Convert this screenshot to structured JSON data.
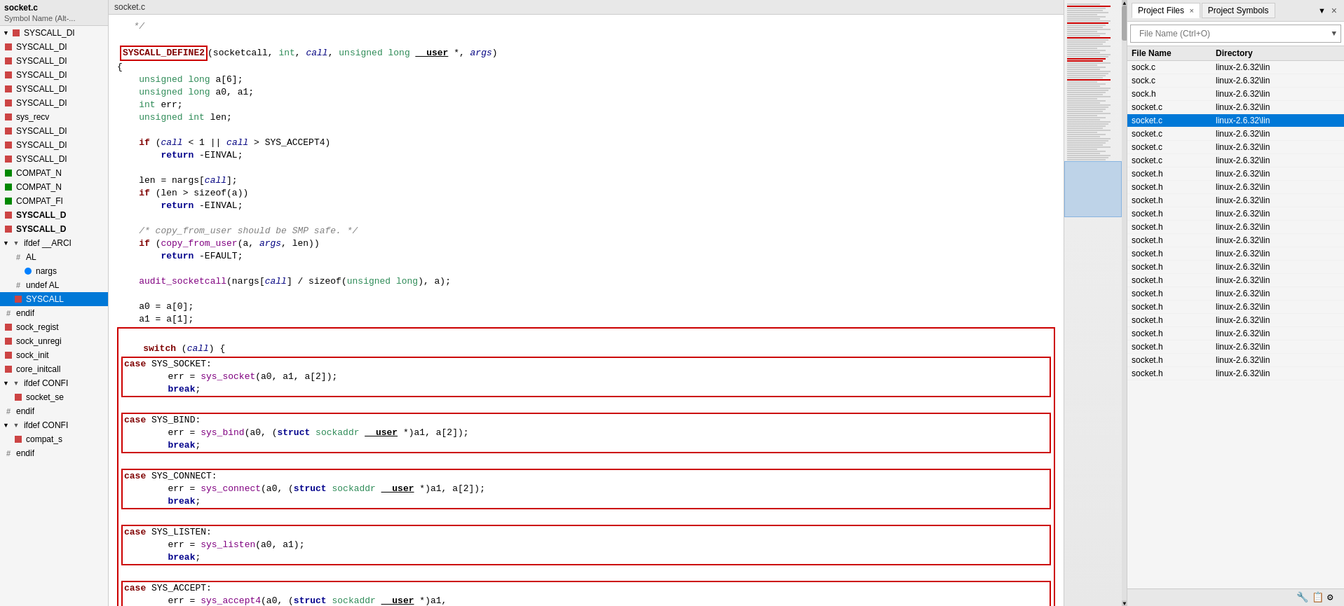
{
  "app": {
    "title": "socket.c"
  },
  "sidebar": {
    "search_placeholder": "Symbol Name (Alt-...",
    "items": [
      {
        "id": "s1",
        "label": "SYSCALL_DI",
        "icon": "sq-red",
        "indent": 0,
        "expanded": true
      },
      {
        "id": "s2",
        "label": "SYSCALL_DI",
        "icon": "sq-red",
        "indent": 0
      },
      {
        "id": "s3",
        "label": "SYSCALL_DI",
        "icon": "sq-red",
        "indent": 0
      },
      {
        "id": "s4",
        "label": "SYSCALL_DI",
        "icon": "sq-red",
        "indent": 0
      },
      {
        "id": "s5",
        "label": "SYSCALL_DI",
        "icon": "sq-red",
        "indent": 0
      },
      {
        "id": "s6",
        "label": "SYSCALL_DI",
        "icon": "sq-red",
        "indent": 0
      },
      {
        "id": "s7",
        "label": "sys_recv",
        "icon": "sq-red",
        "indent": 0
      },
      {
        "id": "s8",
        "label": "SYSCALL_DI",
        "icon": "sq-red",
        "indent": 0
      },
      {
        "id": "s9",
        "label": "SYSCALL_DI",
        "icon": "sq-red",
        "indent": 0
      },
      {
        "id": "s10",
        "label": "SYSCALL_DI",
        "icon": "sq-red",
        "indent": 0
      },
      {
        "id": "s11",
        "label": "COMPAT_N",
        "icon": "sq-green",
        "indent": 0
      },
      {
        "id": "s12",
        "label": "COMPAT_N",
        "icon": "sq-green",
        "indent": 0
      },
      {
        "id": "s13",
        "label": "COMPAT_FI",
        "icon": "sq-green",
        "indent": 0
      },
      {
        "id": "s14",
        "label": "SYSCALL_D",
        "icon": "sq-red",
        "indent": 0,
        "bold": true
      },
      {
        "id": "s15",
        "label": "SYSCALL_D",
        "icon": "sq-red",
        "indent": 0,
        "bold": true
      },
      {
        "id": "s16",
        "label": "ifdef __ARCI",
        "icon": "collapse",
        "indent": 0,
        "expanded": true
      },
      {
        "id": "s17",
        "label": "AL",
        "icon": "hash",
        "indent": 1
      },
      {
        "id": "s18",
        "label": "nargs",
        "icon": "circle-blue",
        "indent": 2
      },
      {
        "id": "s19",
        "label": "undef AL",
        "icon": "hash",
        "indent": 1
      },
      {
        "id": "s20",
        "label": "SYSCALL",
        "icon": "sq-red",
        "indent": 1,
        "selected": true
      },
      {
        "id": "s21",
        "label": "endif",
        "icon": "hash",
        "indent": 0
      },
      {
        "id": "s22",
        "label": "sock_regist",
        "icon": "sq-red",
        "indent": 0
      },
      {
        "id": "s23",
        "label": "sock_unregi",
        "icon": "sq-red",
        "indent": 0
      },
      {
        "id": "s24",
        "label": "sock_init",
        "icon": "sq-red",
        "indent": 0
      },
      {
        "id": "s25",
        "label": "core_initcall",
        "icon": "sq-red",
        "indent": 0
      },
      {
        "id": "s26",
        "label": "ifdef CONFI",
        "icon": "collapse",
        "indent": 0,
        "expanded": true
      },
      {
        "id": "s27",
        "label": "socket_se",
        "icon": "sq-red",
        "indent": 1
      },
      {
        "id": "s28",
        "label": "endif",
        "icon": "hash",
        "indent": 0
      },
      {
        "id": "s29",
        "label": "ifdef CONFI",
        "icon": "collapse",
        "indent": 0,
        "expanded": true
      },
      {
        "id": "s30",
        "label": "compat_s",
        "icon": "sq-red",
        "indent": 1
      },
      {
        "id": "s31",
        "label": "endif",
        "icon": "hash",
        "indent": 0
      }
    ]
  },
  "code": {
    "file": "socket.c",
    "content_lines": []
  },
  "right_panel": {
    "tabs": [
      {
        "label": "Project Files",
        "active": true
      },
      {
        "label": "Project Symbols",
        "active": false
      }
    ],
    "search_placeholder": "File Name (Ctrl+O)",
    "columns": [
      "File Name",
      "Directory"
    ],
    "rows": [
      {
        "filename": "sock.c",
        "directory": "linux-2.6.32\\lin",
        "selected": false
      },
      {
        "filename": "sock.c",
        "directory": "linux-2.6.32\\lin",
        "selected": false
      },
      {
        "filename": "sock.h",
        "directory": "linux-2.6.32\\lin",
        "selected": false
      },
      {
        "filename": "socket.c",
        "directory": "linux-2.6.32\\lin",
        "selected": false
      },
      {
        "filename": "socket.c",
        "directory": "linux-2.6.32\\lin",
        "selected": true
      },
      {
        "filename": "socket.c",
        "directory": "linux-2.6.32\\lin",
        "selected": false
      },
      {
        "filename": "socket.c",
        "directory": "linux-2.6.32\\lin",
        "selected": false
      },
      {
        "filename": "socket.c",
        "directory": "linux-2.6.32\\lin",
        "selected": false
      },
      {
        "filename": "socket.h",
        "directory": "linux-2.6.32\\lin",
        "selected": false
      },
      {
        "filename": "socket.h",
        "directory": "linux-2.6.32\\lin",
        "selected": false
      },
      {
        "filename": "socket.h",
        "directory": "linux-2.6.32\\lin",
        "selected": false
      },
      {
        "filename": "socket.h",
        "directory": "linux-2.6.32\\lin",
        "selected": false
      },
      {
        "filename": "socket.h",
        "directory": "linux-2.6.32\\lin",
        "selected": false
      },
      {
        "filename": "socket.h",
        "directory": "linux-2.6.32\\lin",
        "selected": false
      },
      {
        "filename": "socket.h",
        "directory": "linux-2.6.32\\lin",
        "selected": false
      },
      {
        "filename": "socket.h",
        "directory": "linux-2.6.32\\lin",
        "selected": false
      },
      {
        "filename": "socket.h",
        "directory": "linux-2.6.32\\lin",
        "selected": false
      },
      {
        "filename": "socket.h",
        "directory": "linux-2.6.32\\lin",
        "selected": false
      },
      {
        "filename": "socket.h",
        "directory": "linux-2.6.32\\lin",
        "selected": false
      },
      {
        "filename": "socket.h",
        "directory": "linux-2.6.32\\lin",
        "selected": false
      },
      {
        "filename": "socket.h",
        "directory": "linux-2.6.32\\lin",
        "selected": false
      },
      {
        "filename": "socket.h",
        "directory": "linux-2.6.32\\lin",
        "selected": false
      },
      {
        "filename": "socket.h",
        "directory": "linux-2.6.32\\lin",
        "selected": false
      },
      {
        "filename": "socket.h",
        "directory": "linux-2.6.32\\lin",
        "selected": false
      }
    ]
  }
}
